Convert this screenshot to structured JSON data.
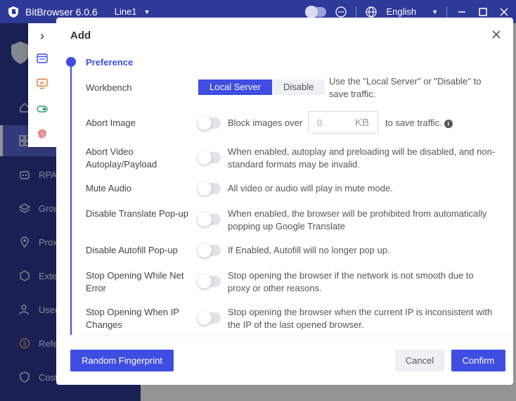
{
  "titlebar": {
    "app_title": "BitBrowser 6.0.6",
    "line": "Line1",
    "language": "English"
  },
  "sidebar": {
    "items": [
      {
        "label": "",
        "icon": "home-icon"
      },
      {
        "label": "",
        "icon": "grid-icon"
      },
      {
        "label": "RPA",
        "icon": "robot-icon"
      },
      {
        "label": "Grou",
        "icon": "layers-icon"
      },
      {
        "label": "Prox",
        "icon": "location-icon"
      },
      {
        "label": "Exte",
        "icon": "cube-icon"
      },
      {
        "label": "User",
        "icon": "user-icon"
      },
      {
        "label": "Refe",
        "icon": "coin-icon"
      },
      {
        "label": "Cost",
        "icon": "shield-icon"
      }
    ]
  },
  "popmenu": {
    "expand_glyph": "›"
  },
  "dialog": {
    "title": "Add",
    "section_title": "Preference",
    "workbench": {
      "label": "Workbench",
      "options": [
        "Local Server",
        "Disable"
      ],
      "selected": "Local Server",
      "description": "Use the \"Local Server\" or \"Disable\" to save traffic."
    },
    "abort_image": {
      "label": "Abort Image",
      "enabled": false,
      "prefix": "Block images over",
      "input_placeholder": "0",
      "unit": "KB",
      "suffix": "to save traffic."
    },
    "abort_video": {
      "label": "Abort Video Autoplay/Payload",
      "enabled": false,
      "description": "When enabled, autoplay and preloading will be disabled, and non-standard formats may be invalid."
    },
    "mute_audio": {
      "label": "Mute Audio",
      "enabled": false,
      "description": "All video or audio will play in mute mode."
    },
    "disable_translate": {
      "label": "Disable Translate Pop-up",
      "enabled": false,
      "description": "When enabled, the browser will be prohibited from automatically popping up Google Translate"
    },
    "disable_autofill": {
      "label": "Disable Autofill Pop-up",
      "enabled": false,
      "description": "If Enabled, Autofill will no longer pop up."
    },
    "stop_net_error": {
      "label": "Stop Opening While Net Error",
      "enabled": false,
      "description": "Stop opening the browser if the network is not smooth due to proxy or other reasons."
    },
    "stop_ip_changes": {
      "label": "Stop Opening When IP Changes",
      "enabled": false,
      "description": "Stop opening the browser when the current IP is inconsistent with the IP of the last opened browser."
    },
    "buttons": {
      "random_fingerprint": "Random Fingerprint",
      "cancel": "Cancel",
      "confirm": "Confirm"
    }
  },
  "colors": {
    "accent": "#3f4de2",
    "sidebar": "#2d3790",
    "titlebar": "#2e3a9a"
  }
}
